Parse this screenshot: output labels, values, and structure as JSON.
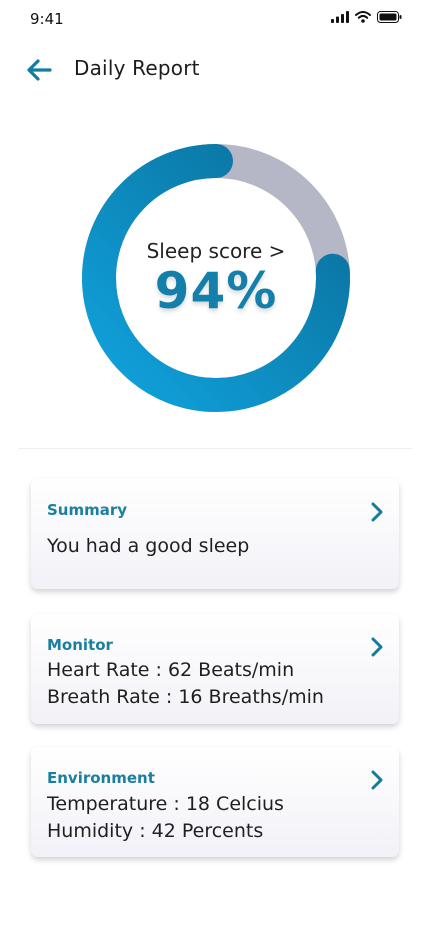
{
  "status_bar": {
    "time": "9:41"
  },
  "header": {
    "title": "Daily Report"
  },
  "sleep_score": {
    "label": "Sleep score >",
    "value_text": "94%",
    "fraction": 0.94
  },
  "cards": [
    {
      "title": "Summary",
      "lines": [
        "You had a good sleep"
      ]
    },
    {
      "title": "Monitor",
      "lines": [
        "Heart Rate  : 62 Beats/min",
        "Breath Rate  : 16 Breaths/min"
      ]
    },
    {
      "title": "Environment",
      "lines": [
        "Temperature  : 18 Celcius",
        "Humidity  : 42 Percents"
      ]
    }
  ],
  "colors": {
    "accent": "#157fab",
    "ring_track": "#b5b6c6",
    "ring_start": "#0b8cc6",
    "ring_end": "#0e6f96"
  },
  "icons": [
    "signal-icon",
    "wifi-icon",
    "battery-icon",
    "back-arrow-icon",
    "chevron-right-icon"
  ]
}
